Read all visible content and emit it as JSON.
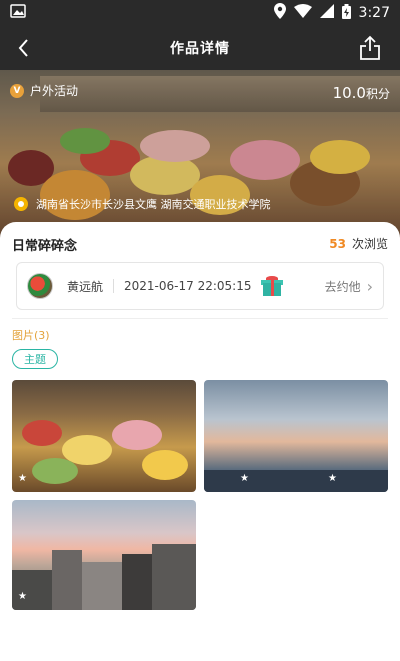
{
  "status_bar": {
    "time": "3:27"
  },
  "header": {
    "title": "作品详情"
  },
  "hero": {
    "activity_label": "户外活动",
    "points_value": "10.0",
    "points_unit": "积分",
    "location": "湖南省长沙市长沙县文鹰 湖南交通职业技术学院"
  },
  "post": {
    "title": "日常碎碎念",
    "views_count": "53",
    "views_label": "次浏览"
  },
  "author": {
    "name": "黄远航",
    "time": "2021-06-17 22:05:15",
    "action": "去约他"
  },
  "pictures": {
    "label": "图片(3)",
    "tag": "主题"
  }
}
